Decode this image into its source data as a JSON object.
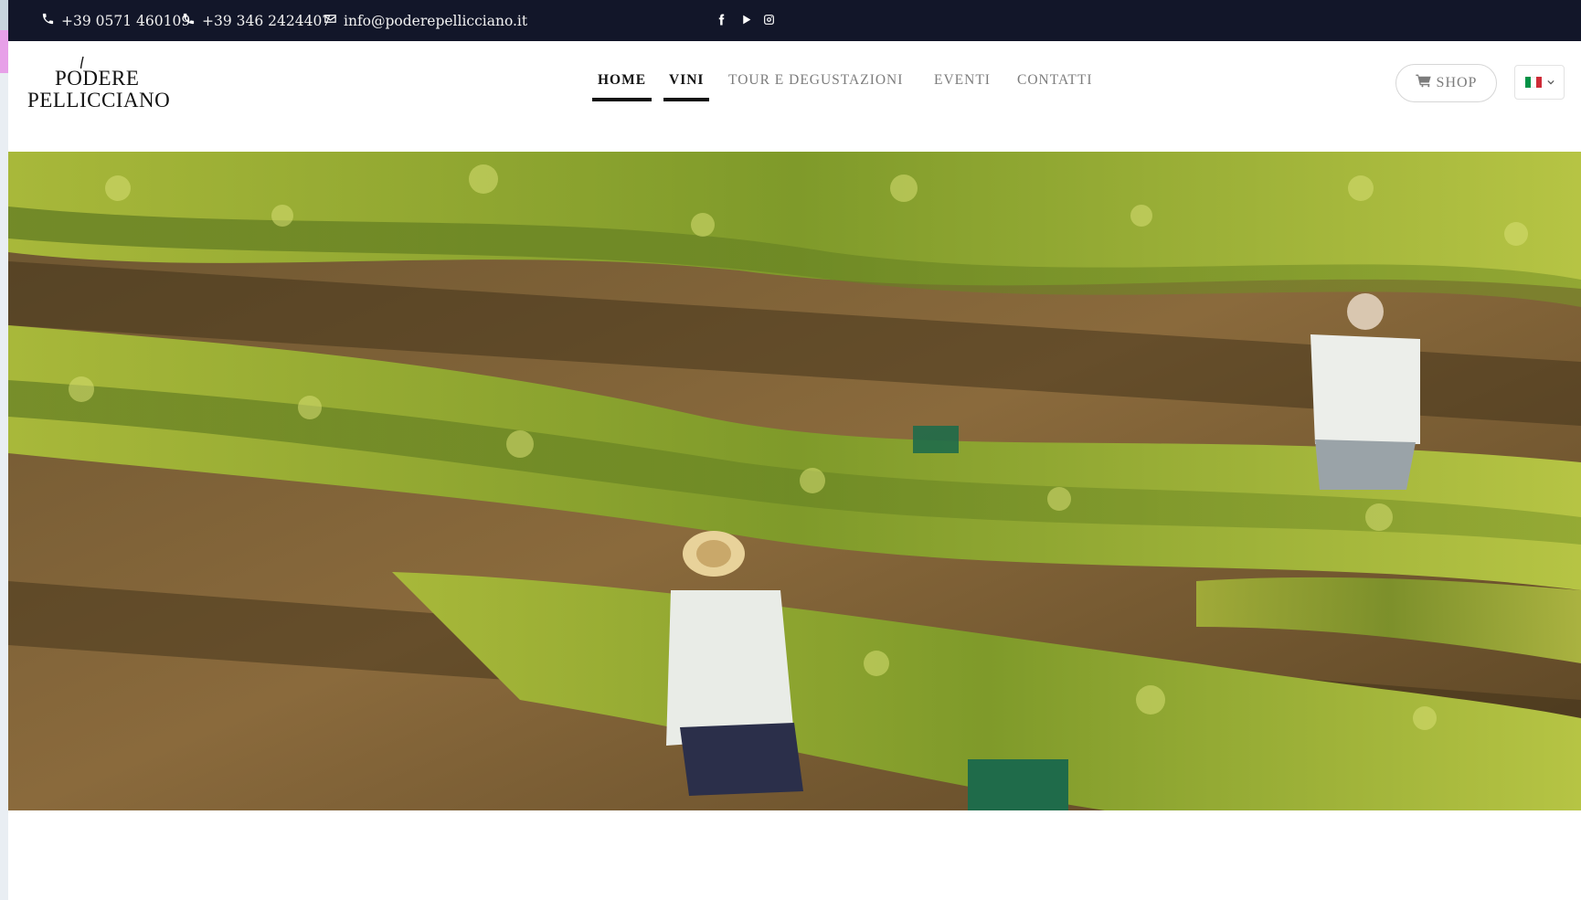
{
  "topbar": {
    "phone1": "+39 0571 460109",
    "phone2": "+39 346 2424407",
    "email": "info@poderepellicciano.it",
    "social": [
      "facebook-icon",
      "youtube-icon",
      "instagram-icon"
    ]
  },
  "brand": {
    "line1": "PODERE",
    "line2": "PELLICCIANO"
  },
  "nav": {
    "items": [
      {
        "label": "HOME",
        "active": true
      },
      {
        "label": "VINI",
        "active": true
      },
      {
        "label": "TOUR E DEGUSTAZIONI",
        "active": false
      },
      {
        "label": "EVENTI",
        "active": false
      },
      {
        "label": "CONTATTI",
        "active": false
      }
    ]
  },
  "shop": {
    "label": "SHOP",
    "icon": "cart-icon"
  },
  "language": {
    "selected": "it",
    "flag_colors": [
      "#009246",
      "#ffffff",
      "#ce2b37"
    ]
  },
  "colors": {
    "topbar": "#121629",
    "active_nav": "#111111",
    "inactive_nav": "#7c7c7c"
  }
}
